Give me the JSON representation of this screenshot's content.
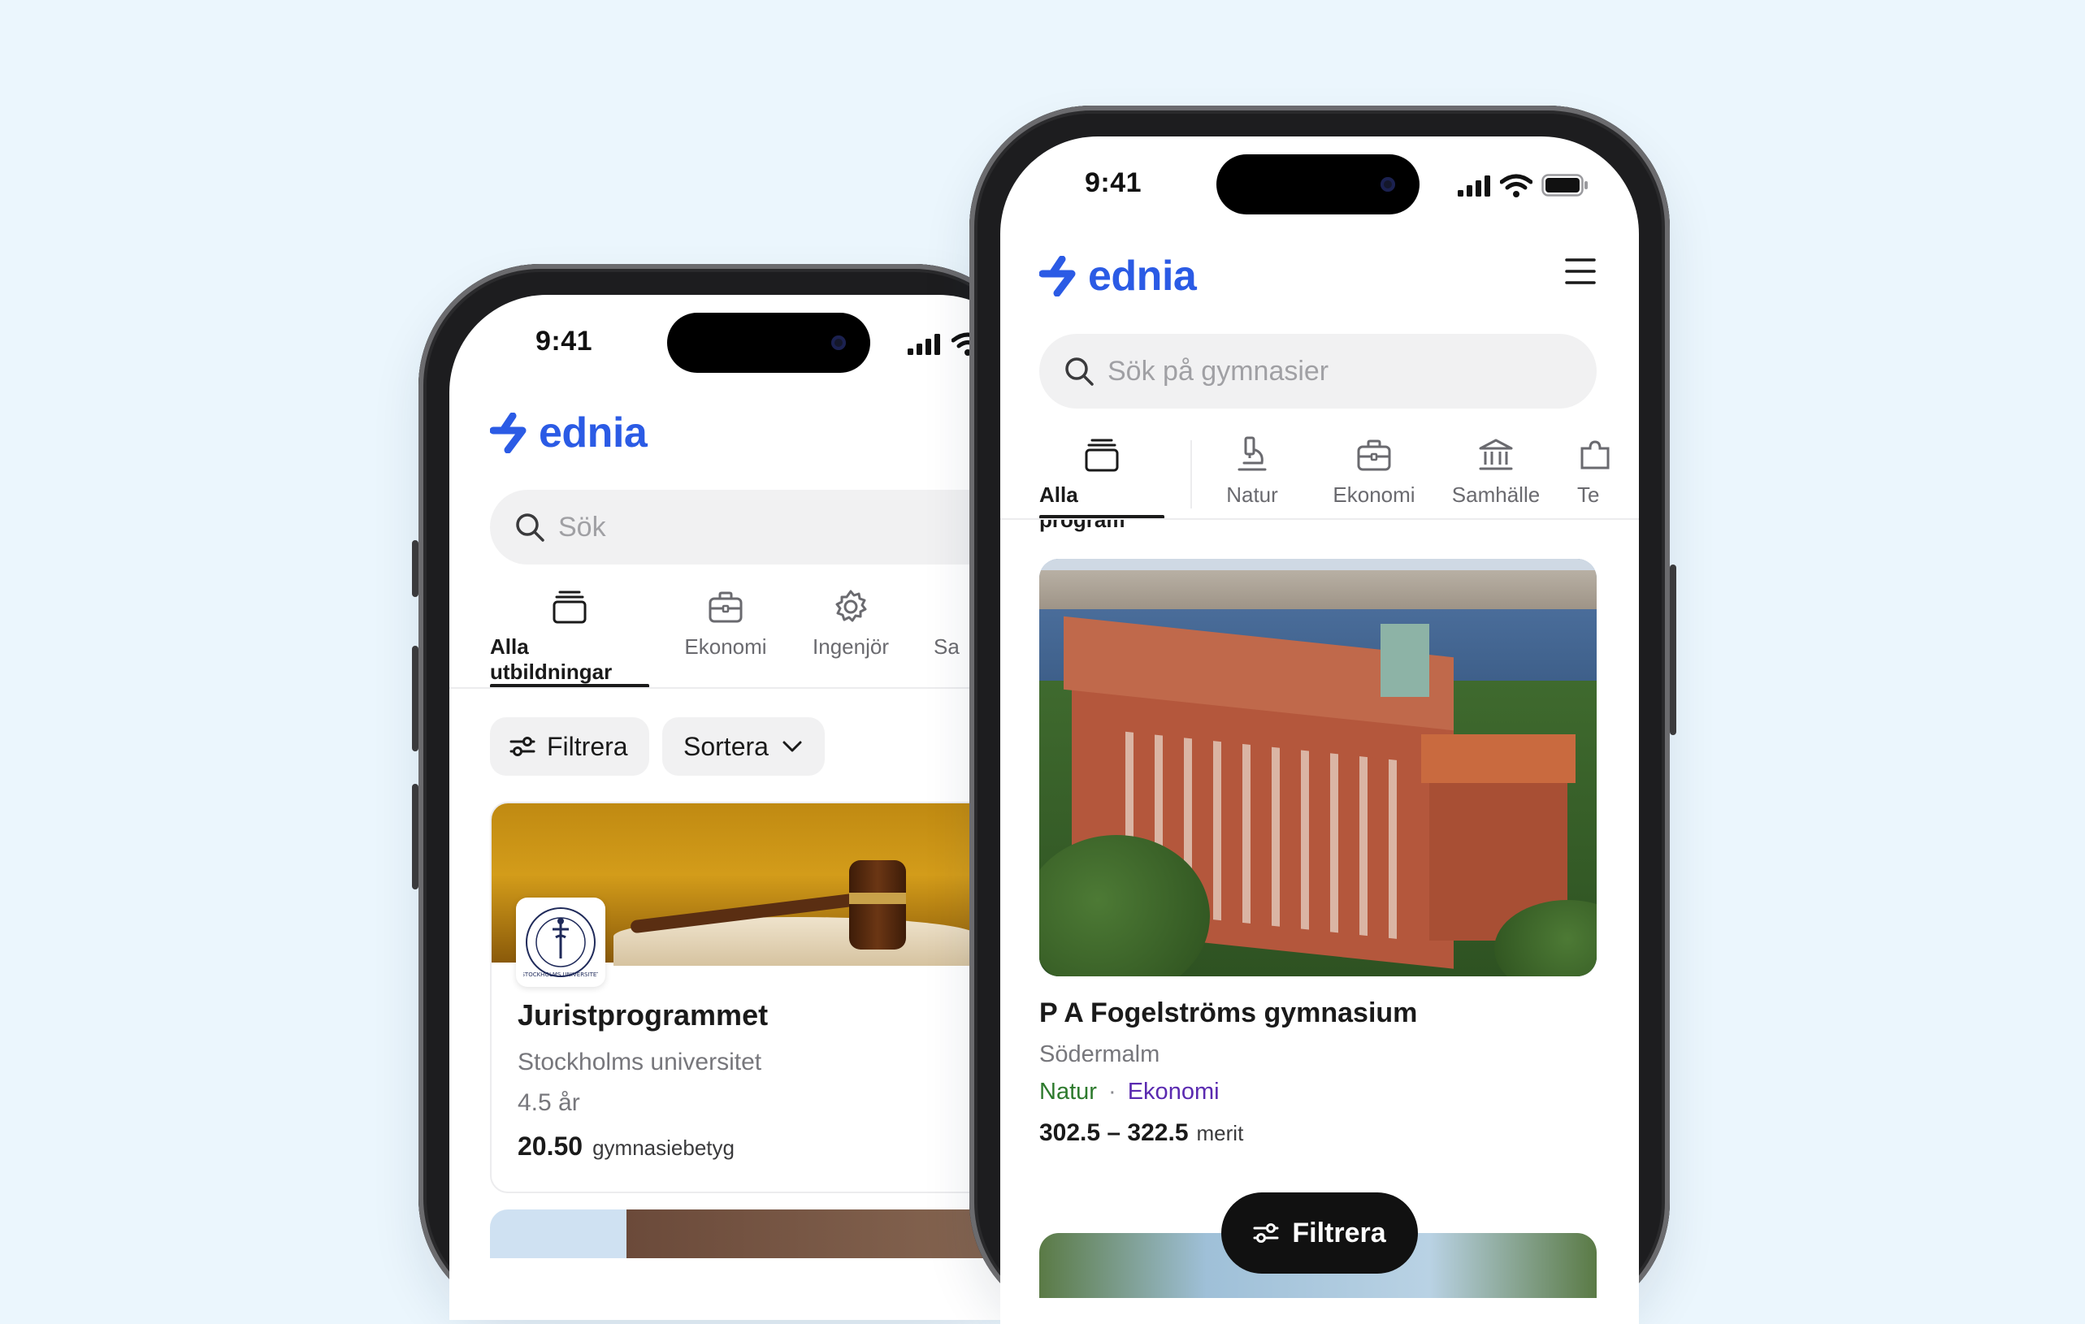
{
  "colors": {
    "background": "#ebf6fd",
    "brand": "#2b5be5",
    "natur": "#2d7a2d",
    "ekonomi": "#5a2ab0"
  },
  "left_phone": {
    "status_time": "9:41",
    "logo": "ednia",
    "search_placeholder": "Sök",
    "tabs": [
      "Alla utbildningar",
      "Ekonomi",
      "Ingenjör",
      "Sa"
    ],
    "filter_label": "Filtrera",
    "sort_label": "Sortera",
    "card": {
      "title": "Juristprogrammet",
      "university": "Stockholms universitet",
      "duration": "4.5 år",
      "score": "20.50",
      "score_unit": "gymnasiebetyg",
      "seal_text": "STOCKHOLMS UNIVERSITET"
    }
  },
  "right_phone": {
    "status_time": "9:41",
    "logo": "ednia",
    "search_placeholder": "Sök på gymnasier",
    "tabs": [
      "Alla program",
      "Natur",
      "Ekonomi",
      "Samhälle",
      "Te"
    ],
    "card": {
      "title": "P A Fogelströms gymnasium",
      "area": "Södermalm",
      "tag_1": "Natur",
      "tag_sep": "·",
      "tag_2": "Ekonomi",
      "score_range": "302.5 – 322.5",
      "score_unit": "merit"
    },
    "float_filter_label": "Filtrera"
  }
}
